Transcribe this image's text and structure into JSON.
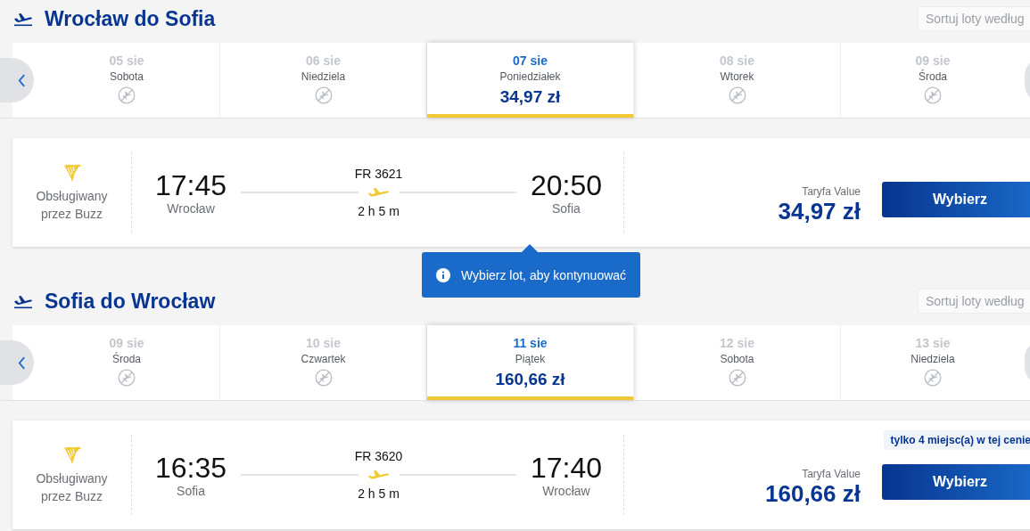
{
  "sections": [
    {
      "title": "Wrocław do Sofia",
      "sort_label": "Sortuj loty według",
      "dates": [
        {
          "date": "05 sie",
          "weekday": "Sobota",
          "selected": false
        },
        {
          "date": "06 sie",
          "weekday": "Niedziela",
          "selected": false
        },
        {
          "date": "07 sie",
          "weekday": "Poniedziałek",
          "price": "34,97 zł",
          "selected": true
        },
        {
          "date": "08 sie",
          "weekday": "Wtorek",
          "selected": false
        },
        {
          "date": "09 sie",
          "weekday": "Środa",
          "selected": false
        }
      ],
      "flight": {
        "operator": "Obsługiwany przez Buzz",
        "departure_time": "17:45",
        "departure_city": "Wrocław",
        "flight_number": "FR 3621",
        "duration": "2 h 5 m",
        "arrival_time": "20:50",
        "arrival_city": "Sofia",
        "fare_label": "Taryfa Value",
        "price": "34,97 zł",
        "button": "Wybierz"
      },
      "tooltip": "Wybierz lot, aby kontynuować"
    },
    {
      "title": "Sofia do Wrocław",
      "sort_label": "Sortuj loty według",
      "dates": [
        {
          "date": "09 sie",
          "weekday": "Środa",
          "selected": false
        },
        {
          "date": "10 sie",
          "weekday": "Czwartek",
          "selected": false
        },
        {
          "date": "11 sie",
          "weekday": "Piątek",
          "price": "160,66 zł",
          "selected": true
        },
        {
          "date": "12 sie",
          "weekday": "Sobota",
          "selected": false
        },
        {
          "date": "13 sie",
          "weekday": "Niedziela",
          "selected": false
        }
      ],
      "flight": {
        "operator": "Obsługiwany przez Buzz",
        "departure_time": "16:35",
        "departure_city": "Sofia",
        "flight_number": "FR 3620",
        "duration": "2 h 5 m",
        "arrival_time": "17:40",
        "arrival_city": "Wrocław",
        "fare_label": "Taryfa Value",
        "price": "160,66 zł",
        "button": "Wybierz",
        "badge": "tylko 4 miejsc(a) w tej cenie"
      }
    }
  ]
}
